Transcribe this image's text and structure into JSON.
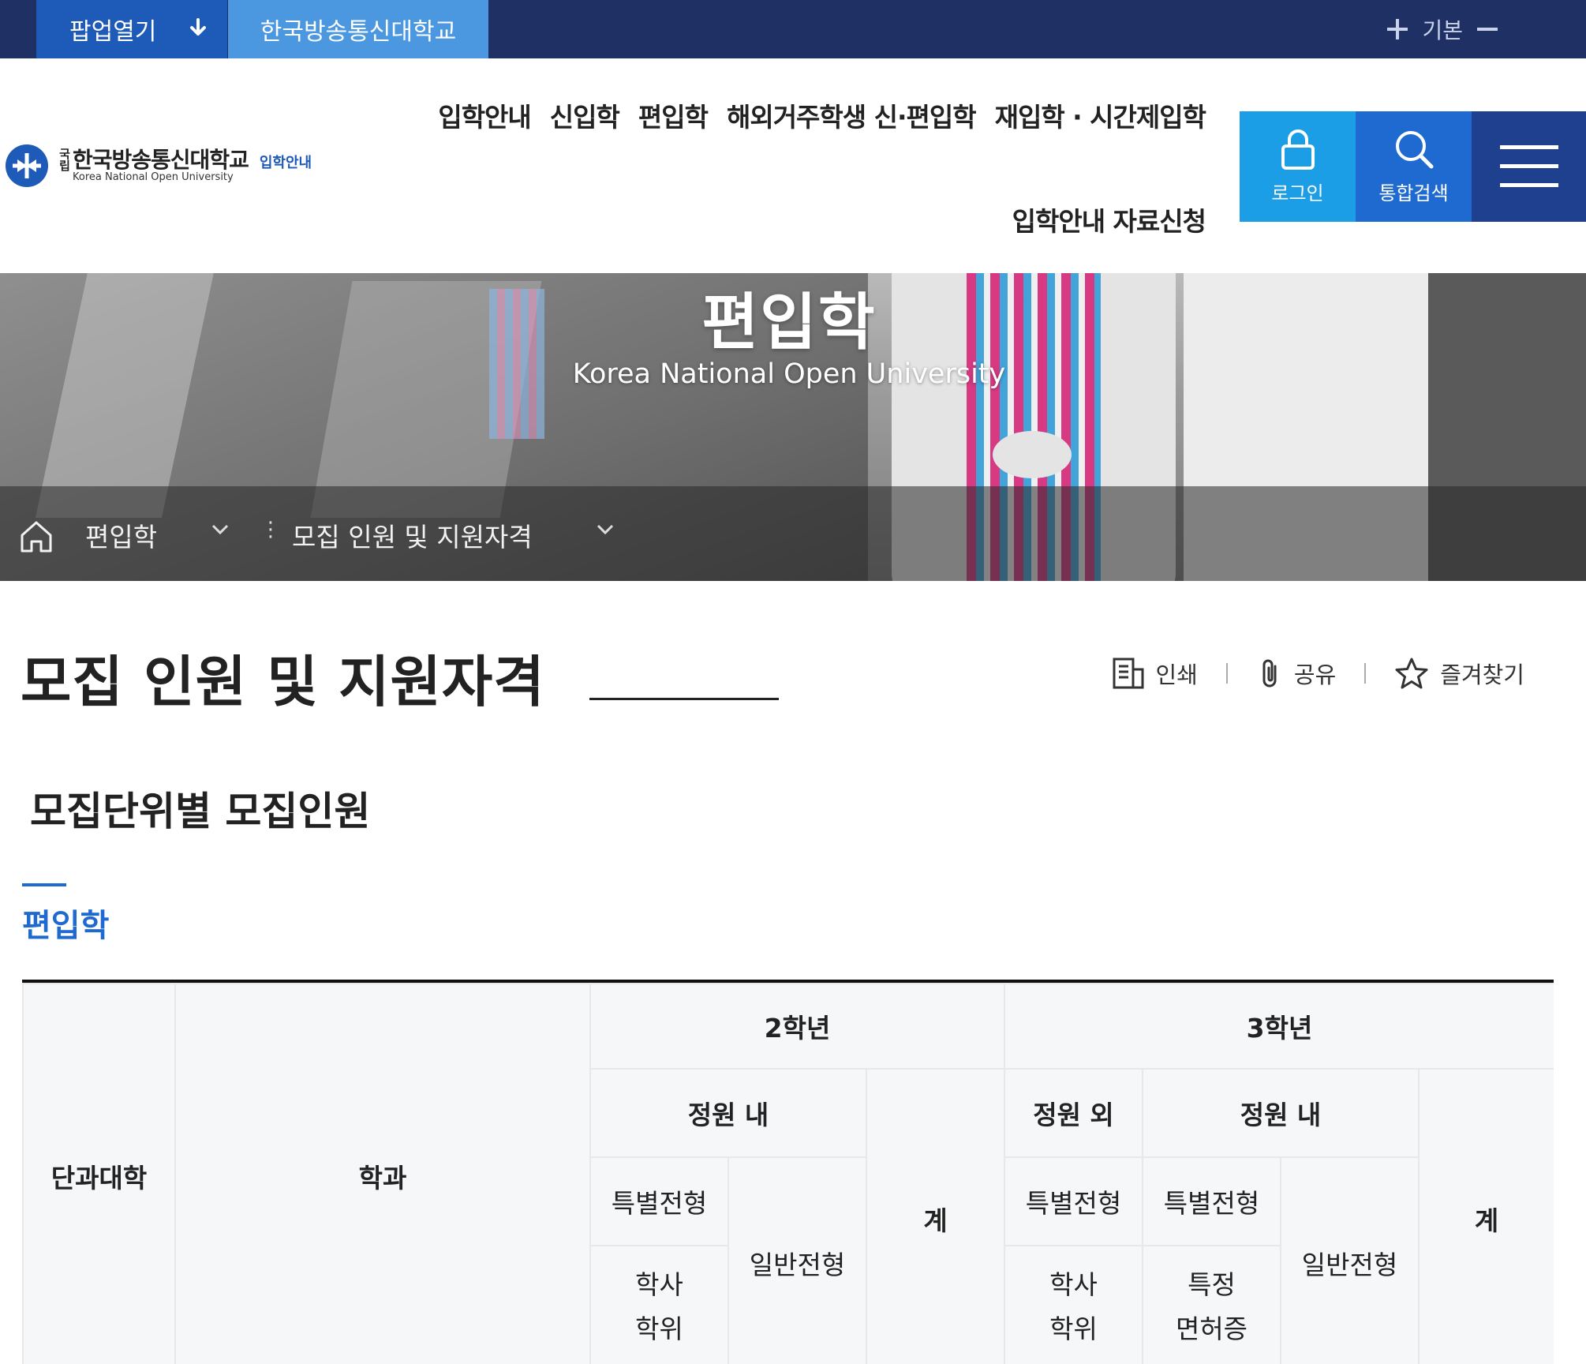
{
  "topbar": {
    "popup_label": "팝업열기",
    "school_tab": "한국방송통신대학교",
    "zoom_label": "기본"
  },
  "header": {
    "logo": {
      "guk": "국립",
      "name": "한국방송통신대학교",
      "english": "Korea National Open University",
      "sub": "입학안내"
    },
    "nav": [
      "입학안내",
      "신입학",
      "편입학",
      "해외거주학생 신·편입학",
      "재입학 · 시간제입학"
    ],
    "nav_row2": "입학안내 자료신청",
    "login_label": "로그인",
    "search_label": "통합검색"
  },
  "banner": {
    "title": "편입학",
    "subtitle": "Korea National Open University",
    "breadcrumb": [
      "편입학",
      "모집 인원 및 지원자격"
    ]
  },
  "content": {
    "page_title": "모집 인원 및 지원자격",
    "actions": {
      "print": "인쇄",
      "share": "공유",
      "bookmark": "즐겨찾기"
    },
    "section_title": "모집단위별 모집인원",
    "tab": "편입학"
  },
  "table": {
    "college": "단과대학",
    "department": "학과",
    "grade2": "2학년",
    "grade3": "3학년",
    "in_quota": "정원 내",
    "out_quota": "정원 외",
    "total": "계",
    "special": "특별전형",
    "general": "일반전형",
    "bachelor_line1": "학사",
    "bachelor_line2": "학위",
    "license_line1": "특정",
    "license_line2": "면허증"
  },
  "colors": {
    "topbar": "#1f3164",
    "accent": "#1e6ad1",
    "login": "#1b9ee6",
    "menu": "#1f3f8f"
  }
}
